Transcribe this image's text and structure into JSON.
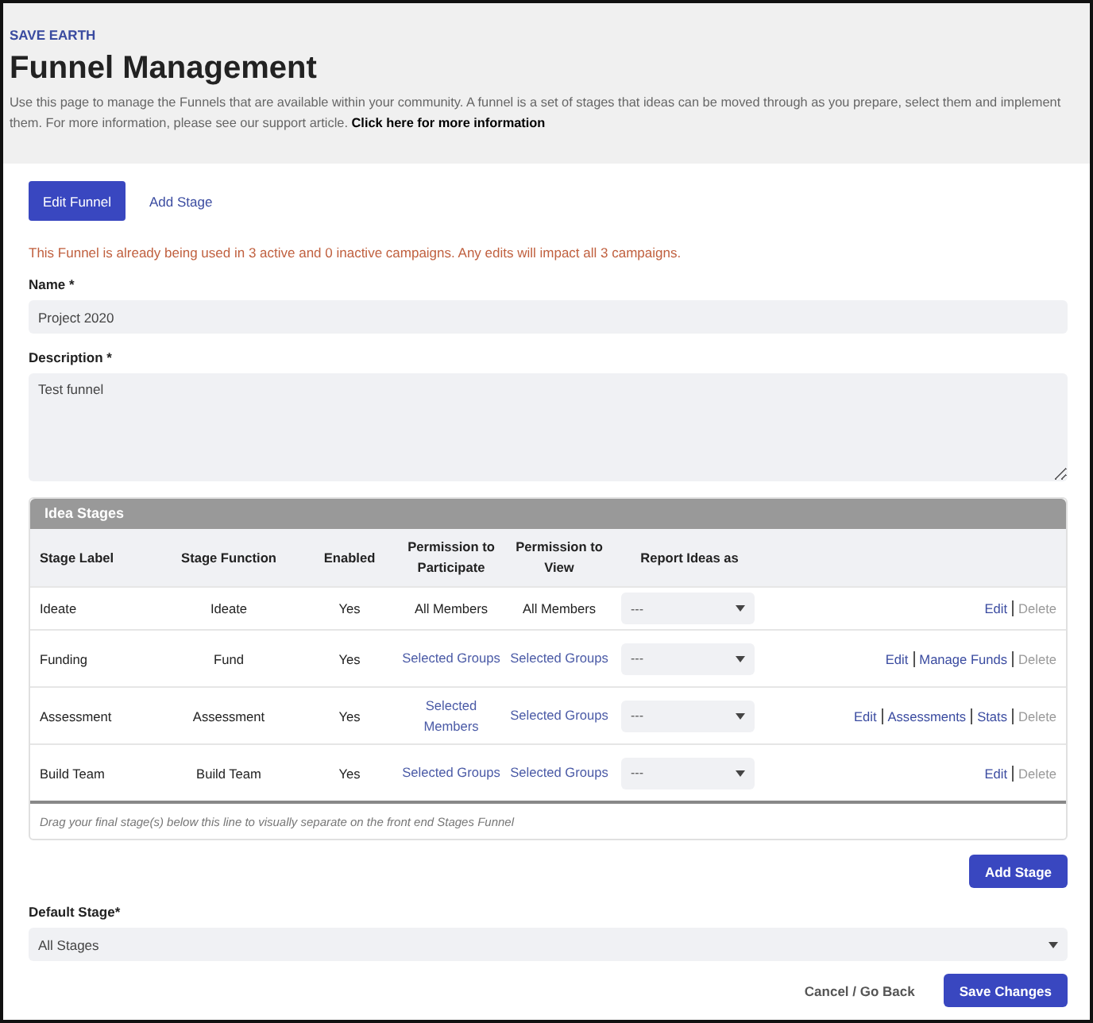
{
  "header": {
    "community": "SAVE EARTH",
    "title": "Funnel Management",
    "intro": "Use this page to manage the Funnels that are available within your community. A funnel is a set of stages that ideas can be moved through as you prepare, select them and implement them. For more information, please see our support article.",
    "info_link": "Click here for more information"
  },
  "tabs": [
    {
      "label": "Edit Funnel",
      "selected": true
    },
    {
      "label": "Add Stage",
      "selected": false
    }
  ],
  "warning": "This Funnel is already being used in 3 active and 0 inactive campaigns. Any edits will impact all 3 campaigns.",
  "name_field": {
    "label": "Name *",
    "value": "Project 2020"
  },
  "description_field": {
    "label": "Description *",
    "value": "Test funnel"
  },
  "idea_stages": {
    "title": "Idea Stages",
    "columns": [
      "Stage Label",
      "Stage Function",
      "Enabled",
      "Permission to Participate",
      "Permission to View",
      "Report Ideas as"
    ],
    "rows": [
      {
        "label": "Ideate",
        "function": "Ideate",
        "enabled": "Yes",
        "participate": {
          "text": "All Members",
          "kind": "text"
        },
        "view": {
          "text": "All Members",
          "kind": "text"
        },
        "report": "---",
        "actions": [
          {
            "label": "Edit",
            "disabled": false
          },
          {
            "label": "Delete",
            "disabled": true
          }
        ]
      },
      {
        "label": "Funding",
        "function": "Fund",
        "enabled": "Yes",
        "participate": {
          "text": "Selected Groups",
          "kind": "link"
        },
        "view": {
          "text": "Selected Groups",
          "kind": "link"
        },
        "report": "---",
        "actions": [
          {
            "label": "Edit",
            "disabled": false
          },
          {
            "label": "Manage Funds",
            "disabled": false
          },
          {
            "label": "Delete",
            "disabled": true
          }
        ]
      },
      {
        "label": "Assessment",
        "function": "Assessment",
        "enabled": "Yes",
        "participate": {
          "text": "Selected Members",
          "kind": "link"
        },
        "view": {
          "text": "Selected Groups",
          "kind": "link"
        },
        "report": "---",
        "actions": [
          {
            "label": "Edit",
            "disabled": false
          },
          {
            "label": "Assessments",
            "disabled": false
          },
          {
            "label": "Stats",
            "disabled": false
          },
          {
            "label": "Delete",
            "disabled": true
          }
        ]
      },
      {
        "label": "Build Team",
        "function": "Build Team",
        "enabled": "Yes",
        "participate": {
          "text": "Selected Groups",
          "kind": "link"
        },
        "view": {
          "text": "Selected Groups",
          "kind": "link"
        },
        "report": "---",
        "actions": [
          {
            "label": "Edit",
            "disabled": false
          },
          {
            "label": "Delete",
            "disabled": true
          }
        ]
      }
    ],
    "drag_hint": "Drag your final stage(s) below this line to visually separate on the front end Stages Funnel",
    "add_button": "Add Stage"
  },
  "default_stage": {
    "label": "Default Stage*",
    "value": "All Stages"
  },
  "footer": {
    "cancel": "Cancel / Go Back",
    "save": "Save Changes"
  }
}
